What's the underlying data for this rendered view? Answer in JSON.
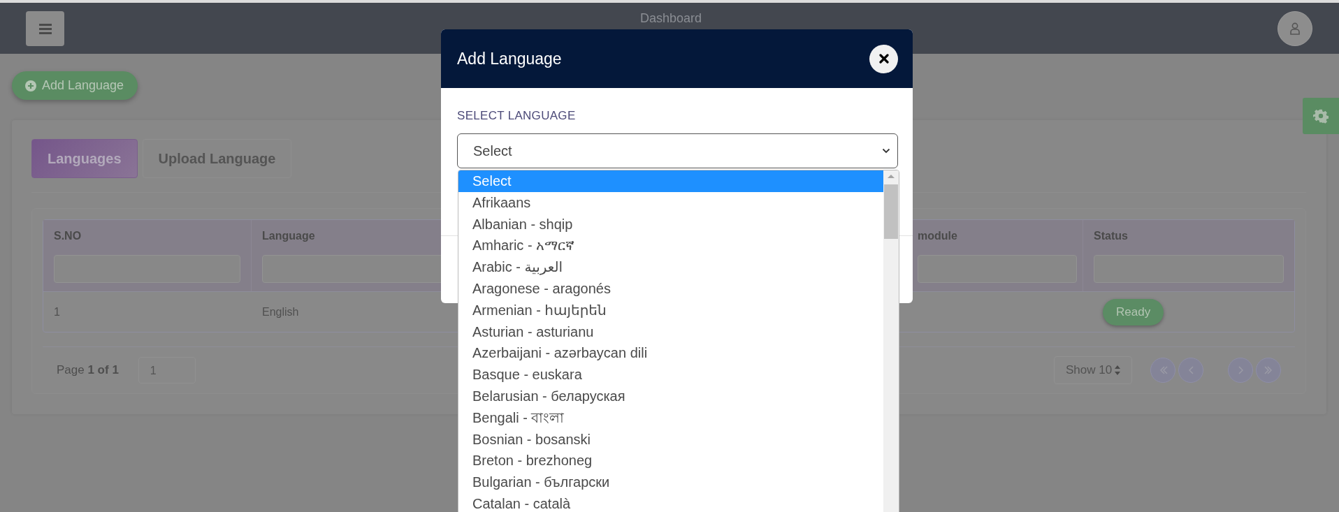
{
  "header": {
    "title": "Dashboard"
  },
  "add_button": {
    "label": "Add Language"
  },
  "tabs": [
    {
      "label": "Languages",
      "selected": true
    },
    {
      "label": "Upload Language",
      "selected": false
    }
  ],
  "table": {
    "columns": [
      "S.NO",
      "Language",
      "module",
      "Status"
    ],
    "rows": [
      {
        "cells": [
          "1",
          "English"
        ],
        "status": "Ready"
      }
    ]
  },
  "pagination": {
    "page_text": "Page **1 of 1**",
    "page_input": "1",
    "page_size": "Show 10"
  },
  "modal": {
    "title": "Add Language",
    "field_label": "SELECT LANGUAGE",
    "select_value": "Select",
    "options": [
      {
        "label": "Select",
        "selected": true
      },
      {
        "label": "Afrikaans",
        "selected": false
      },
      {
        "label": "Albanian - shqip",
        "selected": false
      },
      {
        "label": "Amharic - አማርኛ",
        "selected": false
      },
      {
        "label": "Arabic - العربية",
        "selected": false
      },
      {
        "label": "Aragonese - aragonés",
        "selected": false
      },
      {
        "label": "Armenian - հայերեն",
        "selected": false
      },
      {
        "label": "Asturian - asturianu",
        "selected": false
      },
      {
        "label": "Azerbaijani - azərbaycan dili",
        "selected": false
      },
      {
        "label": "Basque - euskara",
        "selected": false
      },
      {
        "label": "Belarusian - беларуская",
        "selected": false
      },
      {
        "label": "Bengali - বাংলা",
        "selected": false
      },
      {
        "label": "Bosnian - bosanski",
        "selected": false
      },
      {
        "label": "Breton - brezhoneg",
        "selected": false
      },
      {
        "label": "Bulgarian - български",
        "selected": false
      },
      {
        "label": "Catalan - català",
        "selected": false
      }
    ]
  }
}
